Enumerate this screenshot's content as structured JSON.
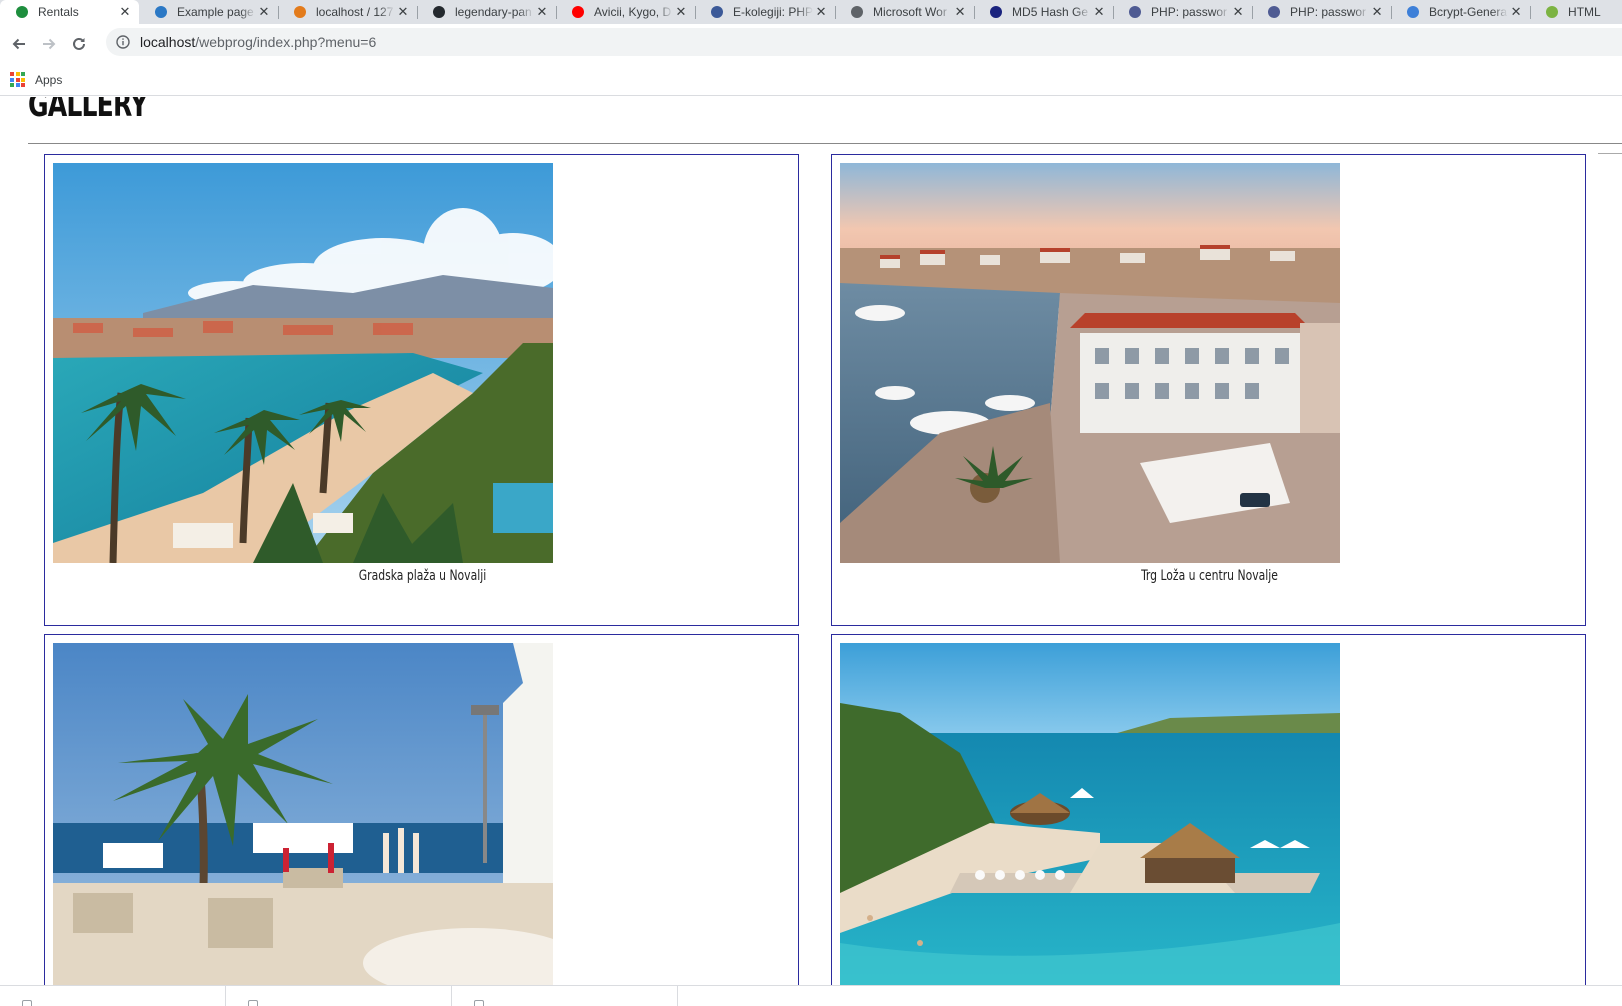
{
  "browser": {
    "tabs": [
      {
        "title": "Rentals",
        "icon": "rentals-favicon",
        "color": "#1e8e3e",
        "active": true
      },
      {
        "title": "Example page",
        "icon": "edge-favicon",
        "color": "#2b78c5"
      },
      {
        "title": "localhost / 127",
        "icon": "phpmyadmin-favicon",
        "color": "#e37b1b"
      },
      {
        "title": "legendary-pan",
        "icon": "github-favicon",
        "color": "#24292e"
      },
      {
        "title": "Avicii, Kygo, D",
        "icon": "youtube-favicon",
        "color": "#ff0000"
      },
      {
        "title": "E-kolegiji: PHP",
        "icon": "graduation-favicon",
        "color": "#3b5998"
      },
      {
        "title": "Microsoft Wor",
        "icon": "globe-favicon",
        "color": "#5f6368"
      },
      {
        "title": "MD5 Hash Ge",
        "icon": "md5-favicon",
        "color": "#1a237e"
      },
      {
        "title": "PHP: passwor",
        "icon": "php-favicon",
        "color": "#4f5b93"
      },
      {
        "title": "PHP: passwor",
        "icon": "php-favicon",
        "color": "#4f5b93"
      },
      {
        "title": "Bcrypt-Genera",
        "icon": "bcrypt-favicon",
        "color": "#3d7fd8"
      },
      {
        "title": "HTML",
        "icon": "html-favicon",
        "color": "#7cb342"
      }
    ],
    "url": {
      "host": "localhost",
      "path": "/webprog/index.php?menu=6"
    },
    "bookmarks": {
      "apps_label": "Apps"
    }
  },
  "page": {
    "title": "GALLERY",
    "gallery": [
      {
        "caption": "Gradska plaža u Novalji",
        "image": "beach-with-palm-trees"
      },
      {
        "caption": "Trg Loža u centru Novalje",
        "image": "harbour-square-aerial"
      },
      {
        "caption": "",
        "image": "seafront-promenade-palm"
      },
      {
        "caption": "",
        "image": "lagoon-beach-bar"
      }
    ]
  }
}
